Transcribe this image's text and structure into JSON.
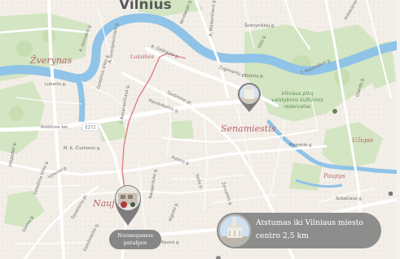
{
  "map": {
    "city_label": "Vilnius",
    "districts": {
      "zverynas": "Žverynas",
      "senamiestis": "Senamiestis",
      "naujamiestis": "Nauj",
      "uzupis": "Užupis",
      "paupys": "Paupys",
      "lukiskes": "Lukiškės"
    },
    "park_label": "Vilniaus pilių valstybinis kultūrinis rezervatas",
    "streets": {
      "seimyniskiu": "Šeimyniškių g.",
      "gostauto": "A. Goštauto g.",
      "gelezinio_vilko_1": "Geležinio Vilko g.",
      "gelezinio_vilko_2": "Geležinio Vilko g.",
      "pamenkalnio": "Pamėnkalnio g.",
      "jasinskio": "A. Jasinskio g.",
      "juozapaviciaus": "A. Juozapavičiaus g.",
      "ciurlionio": "M. K. Čiurlionio g.",
      "vytenio": "Vytenio g.",
      "savanoriu": "Savanorių pr.",
      "kosciuskos": "T. Kosciuškos g.",
      "kauno": "Kauno g.",
      "subaciaus": "Subačiaus g.",
      "traku": "Trakų g.",
      "zygimantu": "Žygimantų g.",
      "ludvino": "Lubarto g.",
      "gedimino": "Gedimino pr.",
      "rodunes": "Rodūnios kel.",
      "basanaviciaus": "J. Basanavičiaus g.",
      "naugarduko": "Naugarduko g.",
      "pylimo": "Pylimo g.",
      "sodu": "Sodų g.",
      "mindaugo": "Mindaugo g.",
      "antakalnio": "Antakalnio g.",
      "olandu": "Olandų g.",
      "maironio": "Maironio g.",
      "vilkpedes": "Vilkpėdės g.",
      "varniu": "Varnių g.",
      "gelezinkelio": "Geležinkelio g.",
      "zemaites": "Žemaitės g.",
      "a_mickeviciaus": "A. Mickevičiaus g.",
      "n_tiltas": "Totorių g.",
      "tilto": "Tilto g.",
      "algirdo": "Algirdo g."
    },
    "route_number": "E272",
    "colors": {
      "background": "#f5f1ea",
      "water": "#8fc3e8",
      "park": "#cfe3bc",
      "road": "#ffffff",
      "route": "#e07f86",
      "district_text": "#b8646a",
      "marker": "#7d7d7d"
    }
  },
  "markers": {
    "destination": {
      "label": "Nuomojamos patalpos",
      "icon": "building-photo-icon"
    },
    "landmark": {
      "icon": "cathedral-photo-icon"
    }
  },
  "info_box": {
    "text": "Atstumas iki Vilniaus miesto centro 2,5 km",
    "icon": "cathedral-photo-icon"
  }
}
